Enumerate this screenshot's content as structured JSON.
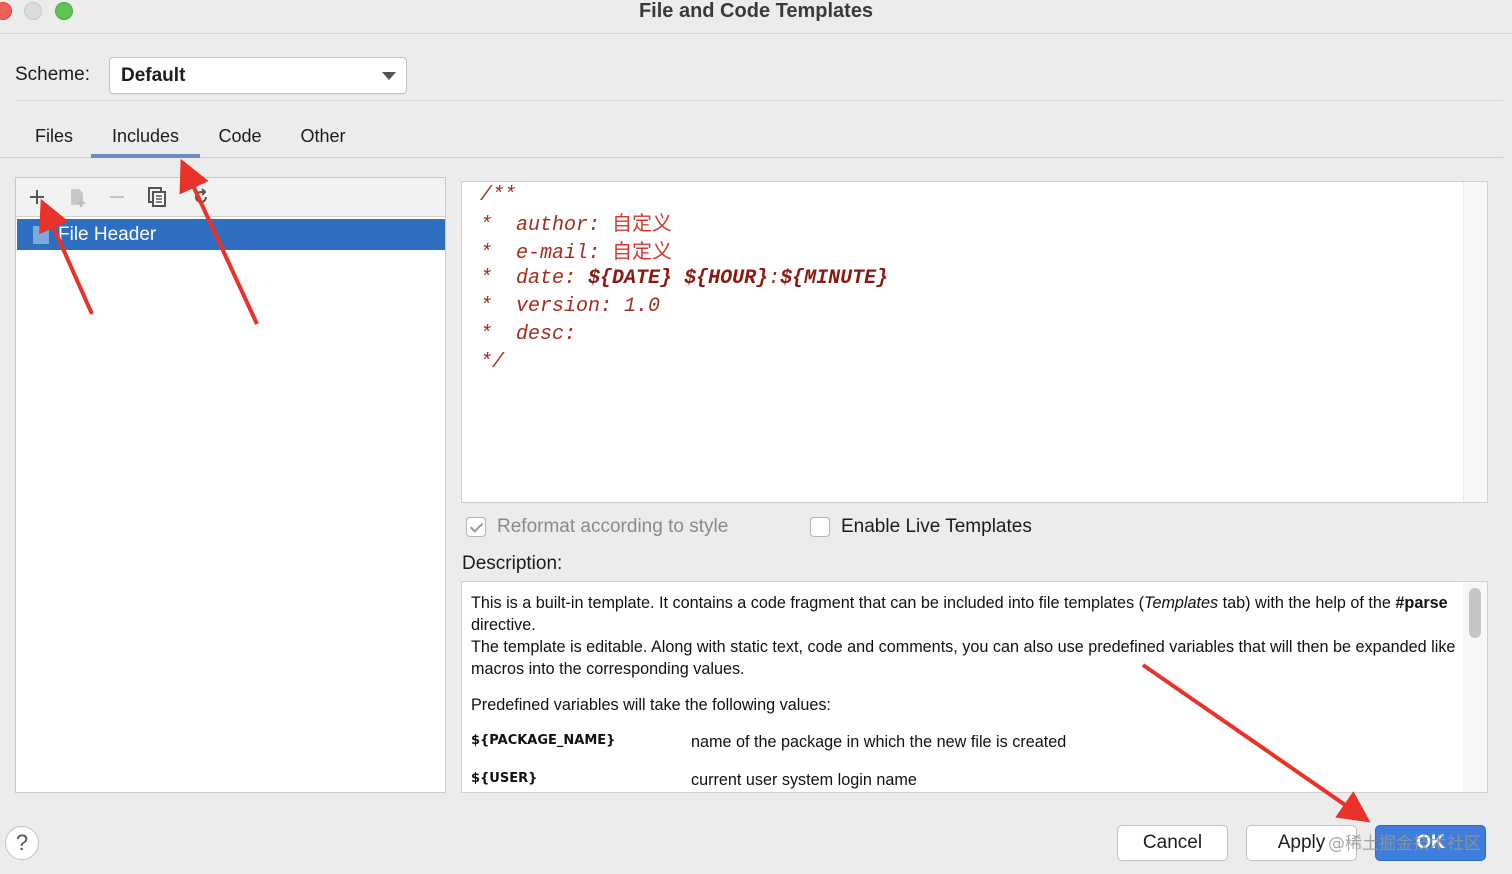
{
  "window": {
    "title": "File and Code Templates"
  },
  "scheme": {
    "label": "Scheme:",
    "value": "Default"
  },
  "tabs": [
    {
      "label": "Files"
    },
    {
      "label": "Includes",
      "active": true
    },
    {
      "label": "Code"
    },
    {
      "label": "Other"
    }
  ],
  "toolbar": {
    "icons": [
      "plus-icon",
      "add-child-icon",
      "minus-icon",
      "copy-icon",
      "reset-icon"
    ]
  },
  "tree": {
    "items": [
      {
        "label": "File Header",
        "selected": true
      }
    ]
  },
  "editor": {
    "lines": {
      "l1": "/**",
      "l2_prefix": "*  author: ",
      "l2_value": "自定义",
      "l3_prefix": "*  e-mail: ",
      "l3_value": "自定义",
      "l4_prefix": "*  date: ",
      "l4_var1": "${DATE}",
      "l4_var2": "${HOUR}",
      "l4_colon": ":",
      "l4_var3": "${MINUTE}",
      "l5": "*  version: 1.0",
      "l6": "*  desc:",
      "l7": "*/"
    },
    "code_color": "#a42d1f"
  },
  "options": {
    "reformat": {
      "label": "Reformat according to style",
      "checked": true,
      "disabled": true
    },
    "live_templates": {
      "label": "Enable Live Templates",
      "checked": false
    }
  },
  "description": {
    "label": "Description:",
    "p1_a": "This is a built-in template. It contains a code fragment that can be included into file templates (",
    "p1_italic": "Templates",
    "p1_b": " tab) with the help of the ",
    "p1_bold": "#parse",
    "p1_c": " directive.",
    "p1_d": "The template is editable. Along with static text, code and comments, you can also use predefined variables that will then be expanded like macros into the corresponding values.",
    "p2": "Predefined variables will take the following values:",
    "variables": [
      {
        "name": "${PACKAGE_NAME}",
        "desc": "name of the package in which the new file is created"
      },
      {
        "name": "${USER}",
        "desc": "current user system login name"
      }
    ]
  },
  "buttons": {
    "help": "?",
    "cancel": "Cancel",
    "apply": "Apply",
    "ok": "OK"
  },
  "watermark": "@稀土掘金技术社区",
  "colors": {
    "accent": "#2f6fc2",
    "ok_button": "#3d7ddc",
    "annotation": "#e8322a"
  }
}
